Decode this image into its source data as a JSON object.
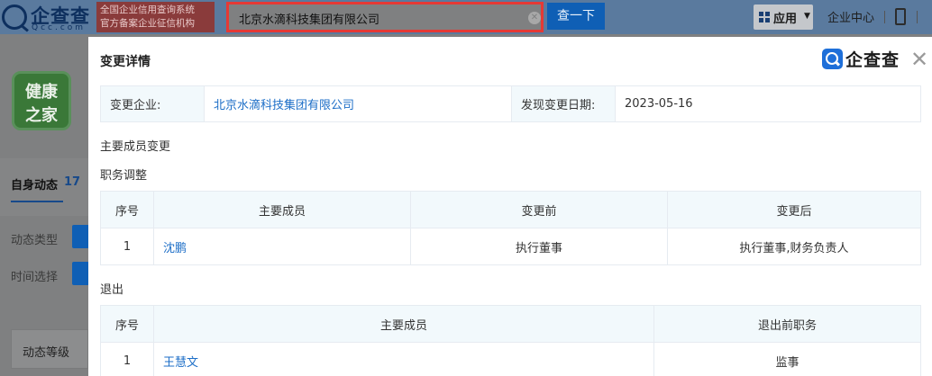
{
  "topbar": {
    "logo_text": "企查查",
    "logo_sub": "Qcc.com",
    "slogan_line1": "全国企业信用查询系统",
    "slogan_line2": "官方备案企业征信机构",
    "search_value": "北京水滴科技集团有限公司",
    "search_button": "查一下",
    "apps_label": "应用",
    "enterprise_center": "企业中心"
  },
  "sidebar": {
    "logo_line1": "健康",
    "logo_line2": "之家",
    "tab_label": "自身动态",
    "tab_count": "17",
    "filter_type_label": "动态类型",
    "filter_time_label": "时间选择",
    "level_label": "动态等级"
  },
  "modal": {
    "title": "变更详情",
    "brand": "企查查",
    "info": {
      "company_key": "变更企业:",
      "company_value": "北京水滴科技集团有限公司",
      "date_key": "发现变更日期:",
      "date_value": "2023-05-16"
    },
    "section_main": "主要成员变更",
    "section_adjust": "职务调整",
    "adjust_table": {
      "headers": [
        "序号",
        "主要成员",
        "变更前",
        "变更后"
      ],
      "rows": [
        {
          "no": "1",
          "name": "沈鹏",
          "before": "执行董事",
          "after": "执行董事,财务负责人"
        }
      ]
    },
    "section_exit": "退出",
    "exit_table": {
      "headers": [
        "序号",
        "主要成员",
        "退出前职务"
      ],
      "rows": [
        {
          "no": "1",
          "name": "王慧文",
          "position": "监事"
        }
      ]
    }
  }
}
